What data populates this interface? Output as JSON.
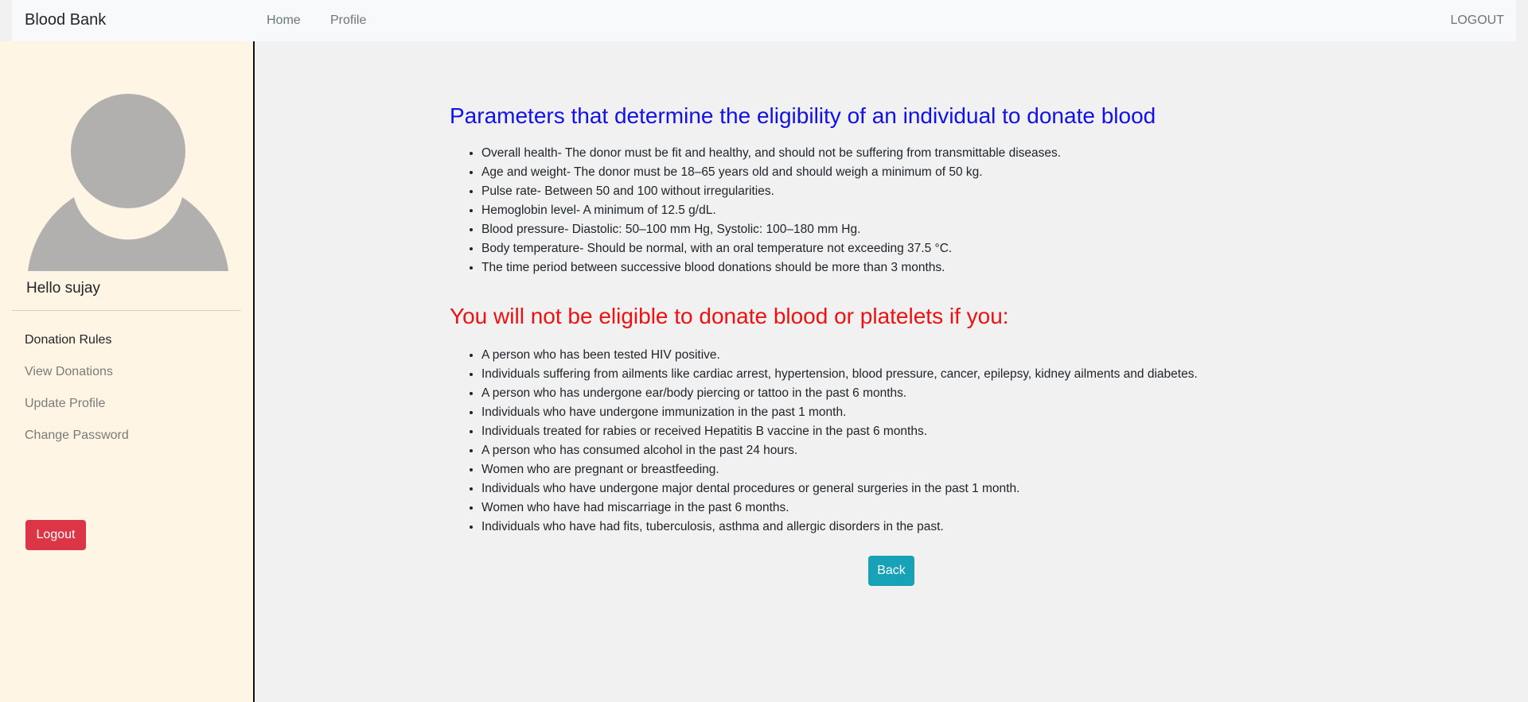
{
  "navbar": {
    "brand": "Blood Bank",
    "links": [
      {
        "label": "Home"
      },
      {
        "label": "Profile"
      }
    ],
    "logout": "LOGOUT"
  },
  "sidebar": {
    "greeting": "Hello sujay",
    "items": [
      {
        "label": "Donation Rules"
      },
      {
        "label": "View Donations"
      },
      {
        "label": "Update Profile"
      },
      {
        "label": "Change Password"
      }
    ],
    "logout_button": "Logout"
  },
  "main": {
    "eligibility_heading": "Parameters that determine the eligibility of an individual to donate blood",
    "eligibility_items": [
      "Overall health- The donor must be fit and healthy, and should not be suffering from transmittable diseases.",
      "Age and weight- The donor must be 18–65 years old and should weigh a minimum of 50 kg.",
      "Pulse rate- Between 50 and 100 without irregularities.",
      "Hemoglobin level- A minimum of 12.5 g/dL.",
      "Blood pressure- Diastolic: 50–100 mm Hg, Systolic: 100–180 mm Hg.",
      "Body temperature- Should be normal, with an oral temperature not exceeding 37.5 °C.",
      "The time period between successive blood donations should be more than 3 months."
    ],
    "ineligible_heading": "You will not be eligible to donate blood or platelets if you:",
    "ineligible_items": [
      "A person who has been tested HIV positive.",
      "Individuals suffering from ailments like cardiac arrest, hypertension, blood pressure, cancer, epilepsy, kidney ailments and diabetes.",
      "A person who has undergone ear/body piercing or tattoo in the past 6 months.",
      "Individuals who have undergone immunization in the past 1 month.",
      "Individuals treated for rabies or received Hepatitis B vaccine in the past 6 months.",
      "A person who has consumed alcohol in the past 24 hours.",
      "Women who are pregnant or breastfeeding.",
      "Individuals who have undergone major dental procedures or general surgeries in the past 1 month.",
      "Women who have had miscarriage in the past 6 months.",
      "Individuals who have had fits, tuberculosis, asthma and allergic disorders in the past."
    ],
    "back_button": "Back"
  },
  "colors": {
    "sidebar_bg": "#fff5e5",
    "heading_blue": "#1111e8",
    "heading_red": "#ee1111",
    "logout_red": "#dc3545",
    "back_teal": "#17a2b8"
  },
  "icons": {
    "avatar": "user-avatar-icon"
  }
}
